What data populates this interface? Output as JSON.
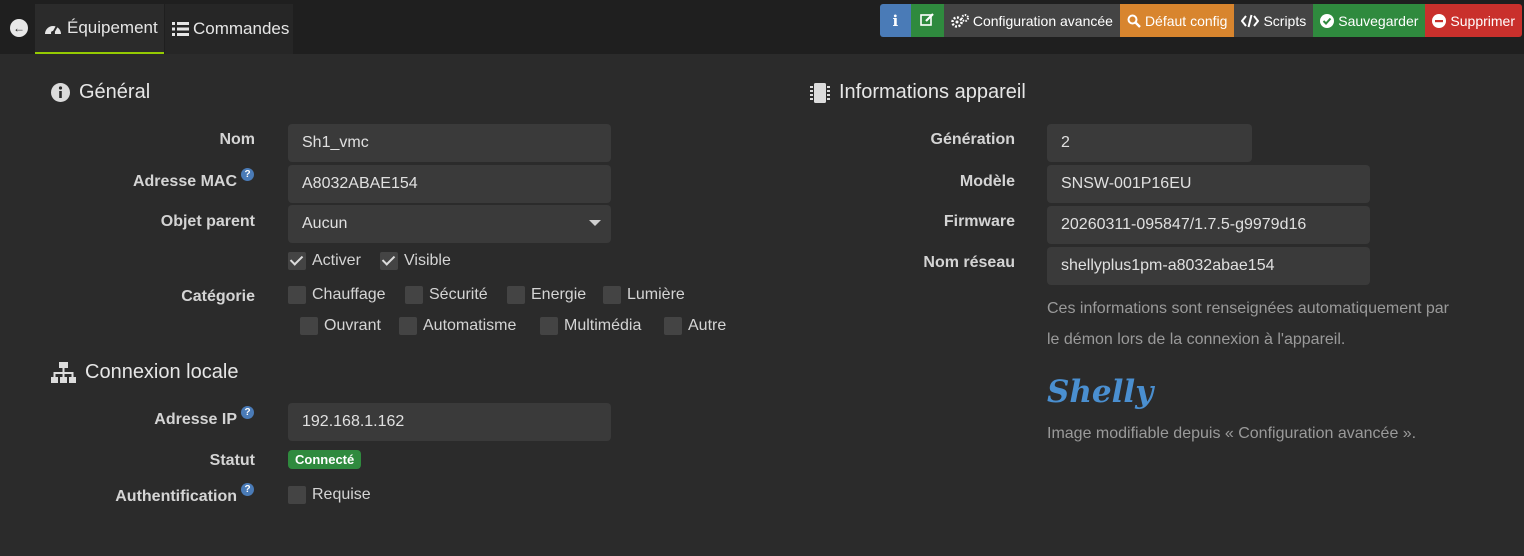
{
  "tabs": {
    "equipment": "Équipement",
    "commands": "Commandes"
  },
  "actions": {
    "advanced_config": "Configuration avancée",
    "default_config": "Défaut config",
    "scripts": "Scripts",
    "save": "Sauvegarder",
    "delete": "Supprimer"
  },
  "general": {
    "title": "Général",
    "name_label": "Nom",
    "name_value": "Sh1_vmc",
    "mac_label": "Adresse MAC",
    "mac_value": "A8032ABAE154",
    "parent_label": "Objet parent",
    "parent_value": "Aucun",
    "activate_label": "Activer",
    "visible_label": "Visible",
    "category_label": "Catégorie",
    "categories": [
      "Chauffage",
      "Sécurité",
      "Energie",
      "Lumière",
      "Ouvrant",
      "Automatisme",
      "Multimédia",
      "Autre"
    ]
  },
  "local": {
    "title": "Connexion locale",
    "ip_label": "Adresse IP",
    "ip_value": "192.168.1.162",
    "status_label": "Statut",
    "status_value": "Connecté",
    "auth_label": "Authentification",
    "auth_option": "Requise"
  },
  "device": {
    "title": "Informations appareil",
    "generation_label": "Génération",
    "generation_value": "2",
    "model_label": "Modèle",
    "model_value": "SNSW-001P16EU",
    "firmware_label": "Firmware",
    "firmware_value": "20260311-095847/1.7.5-g9979d16",
    "network_label": "Nom réseau",
    "network_value": "shellyplus1pm-a8032abae154",
    "note_line1": "Ces informations sont renseignées automatiquement par",
    "note_line2": "le démon lors de la connexion à l'appareil.",
    "logo_text": "Shelly",
    "image_note": "Image modifiable depuis « Configuration avancée »."
  },
  "colors": {
    "background": "#2b2b2b",
    "topbar": "#1f1f1f",
    "field": "#3a3a3a",
    "info": "#4a7bb7",
    "success": "#2f8a3e",
    "warning": "#d8852e",
    "danger": "#c9302c",
    "tab_underline": "#94ca02",
    "logo": "#4a8fd0"
  },
  "icons": {
    "back": "arrow-left-circle-icon",
    "equipment": "tachometer-icon",
    "commands": "list-icon",
    "general": "info-circle-icon",
    "local": "sitemap-icon",
    "device": "microchip-icon",
    "help": "question-circle-icon"
  }
}
